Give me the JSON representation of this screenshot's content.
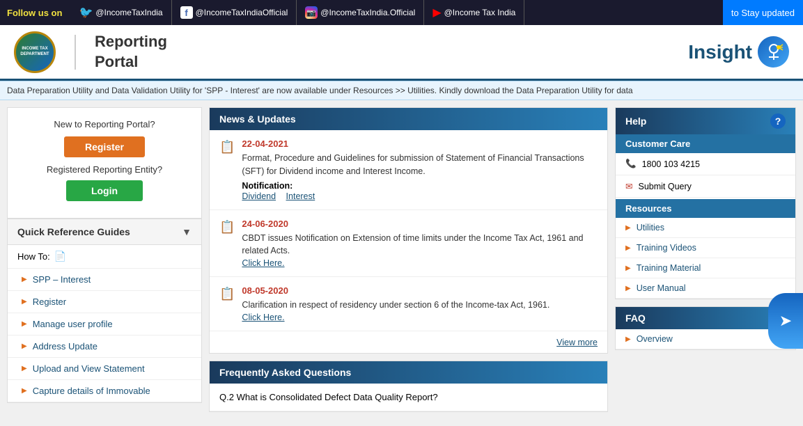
{
  "social_bar": {
    "follow_text": "Follow us on",
    "twitter_handle": "@IncomeTaxIndia",
    "facebook_handle": "@IncomeTaxIndiaOfficial",
    "instagram_handle": "@IncomeTaxIndia.Official",
    "youtube_handle": "@Income Tax India",
    "stay_updated": "to Stay updated"
  },
  "header": {
    "logo_text": "INCOME TAX DEPARTMENT",
    "title_line1": "Reporting",
    "title_line2": "Portal",
    "insight_label": "Insight"
  },
  "ticker": {
    "text": "Data Preparation Utility and Data Validation Utility for 'SPP - Interest' are now available under Resources >> Utilities. Kindly download the Data Preparation Utility for data"
  },
  "left_sidebar": {
    "new_text": "New to Reporting Portal?",
    "register_label": "Register",
    "registered_text": "Registered Reporting Entity?",
    "login_label": "Login",
    "qrg_title": "Quick Reference Guides",
    "how_to": "How To:",
    "links": [
      "SPP – Interest",
      "Register",
      "Manage user profile",
      "Address Update",
      "Upload and View Statement",
      "Capture details of Immovable"
    ]
  },
  "news": {
    "section_title": "News & Updates",
    "items": [
      {
        "date": "22-04-2021",
        "text": "Format, Procedure and Guidelines for submission of Statement of Financial Transactions (SFT) for Dividend income and Interest Income.",
        "notification_label": "Notification:",
        "links": [
          "Dividend",
          "Interest"
        ]
      },
      {
        "date": "24-06-2020",
        "text": "CBDT issues Notification on Extension of time limits under the Income Tax Act, 1961 and related Acts.",
        "links": [
          "Click Here."
        ]
      },
      {
        "date": "08-05-2020",
        "text": "Clarification in respect of residency under section 6 of the Income-tax Act, 1961.",
        "links": [
          "Click Here."
        ]
      }
    ],
    "view_more": "View more"
  },
  "faq": {
    "section_title": "Frequently Asked Questions",
    "question": "Q.2 What is Consolidated Defect Data Quality Report?"
  },
  "help": {
    "title": "Help",
    "customer_care_title": "Customer Care",
    "phone": "1800 103 4215",
    "submit_query": "Submit Query",
    "resources_title": "Resources",
    "resource_items": [
      "Utilities",
      "Training Videos",
      "Training Material",
      "User Manual"
    ],
    "faq_title": "FAQ",
    "faq_items": [
      "Overview"
    ]
  }
}
